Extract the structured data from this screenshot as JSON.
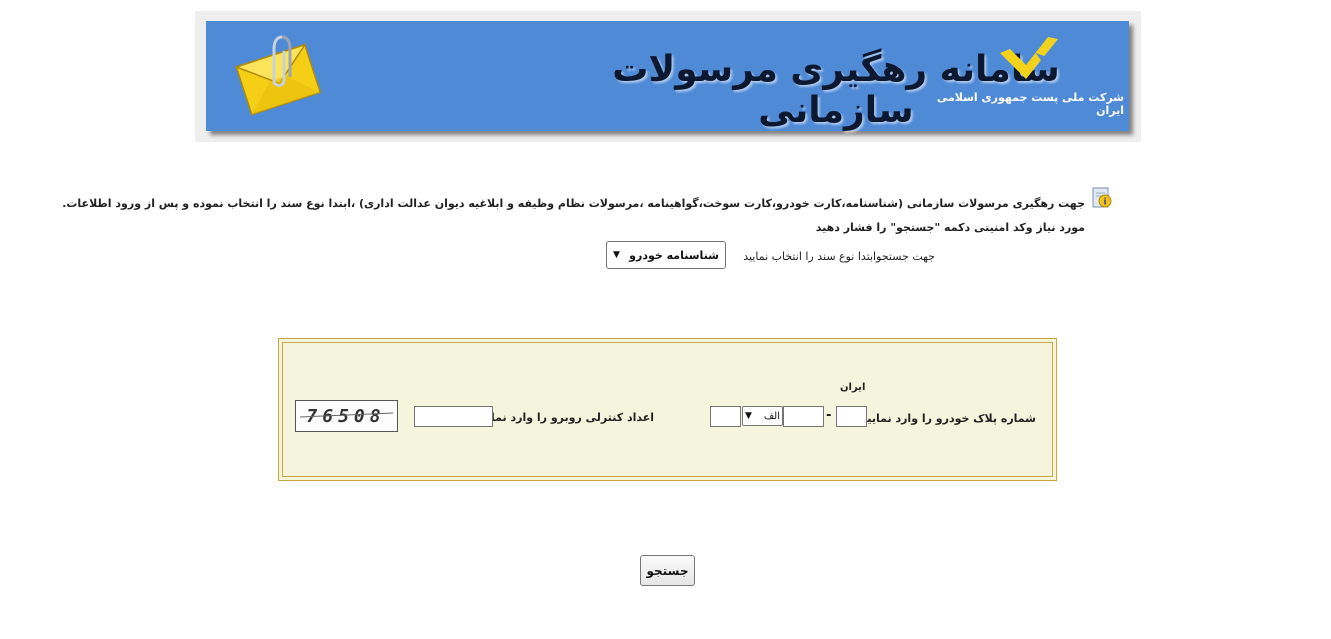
{
  "header": {
    "title": "سامانه رهگیری مرسولات سازمانی",
    "company": "شرکت ملی پست جمهوری اسلامی ایران",
    "logo_icon": "post-bird-logo",
    "envelope_icon": "envelope-icon"
  },
  "instructions": {
    "line1": "جهت رهگیری مرسولات سازمانی (شناسنامه،کارت خودرو،کارت سوخت،گواهینامه ،مرسولات نظام وظیفه  و ابلاغیه دیوان عدالت اداری) ،ابتدا  نوع سند را انتخاب نموده و پس از ورود اطلاعات.",
    "line2": "مورد نیاز وکد امنیتی دکمه \"جستجو\" را فشار دهید",
    "select_label": "جهت جستجوابتدا نوع سند را انتخاب نمایید",
    "select_value": "شناسنامه خودرو"
  },
  "form": {
    "iran_label": "ایران",
    "plate_label": "شماره پلاک خودرو را وارد نمایید:",
    "plate_dash": "-",
    "plate_letter_value": "الف",
    "captcha_label": "اعداد کنترلی روبرو را وارد نمایید:",
    "captcha_text": "76508"
  },
  "actions": {
    "search_label": "جستجو"
  },
  "colors": {
    "banner": "#4f8ad6",
    "form_bg": "#f5f4dc",
    "form_border": "#c9a742",
    "logo_yellow": "#f2d21a"
  }
}
